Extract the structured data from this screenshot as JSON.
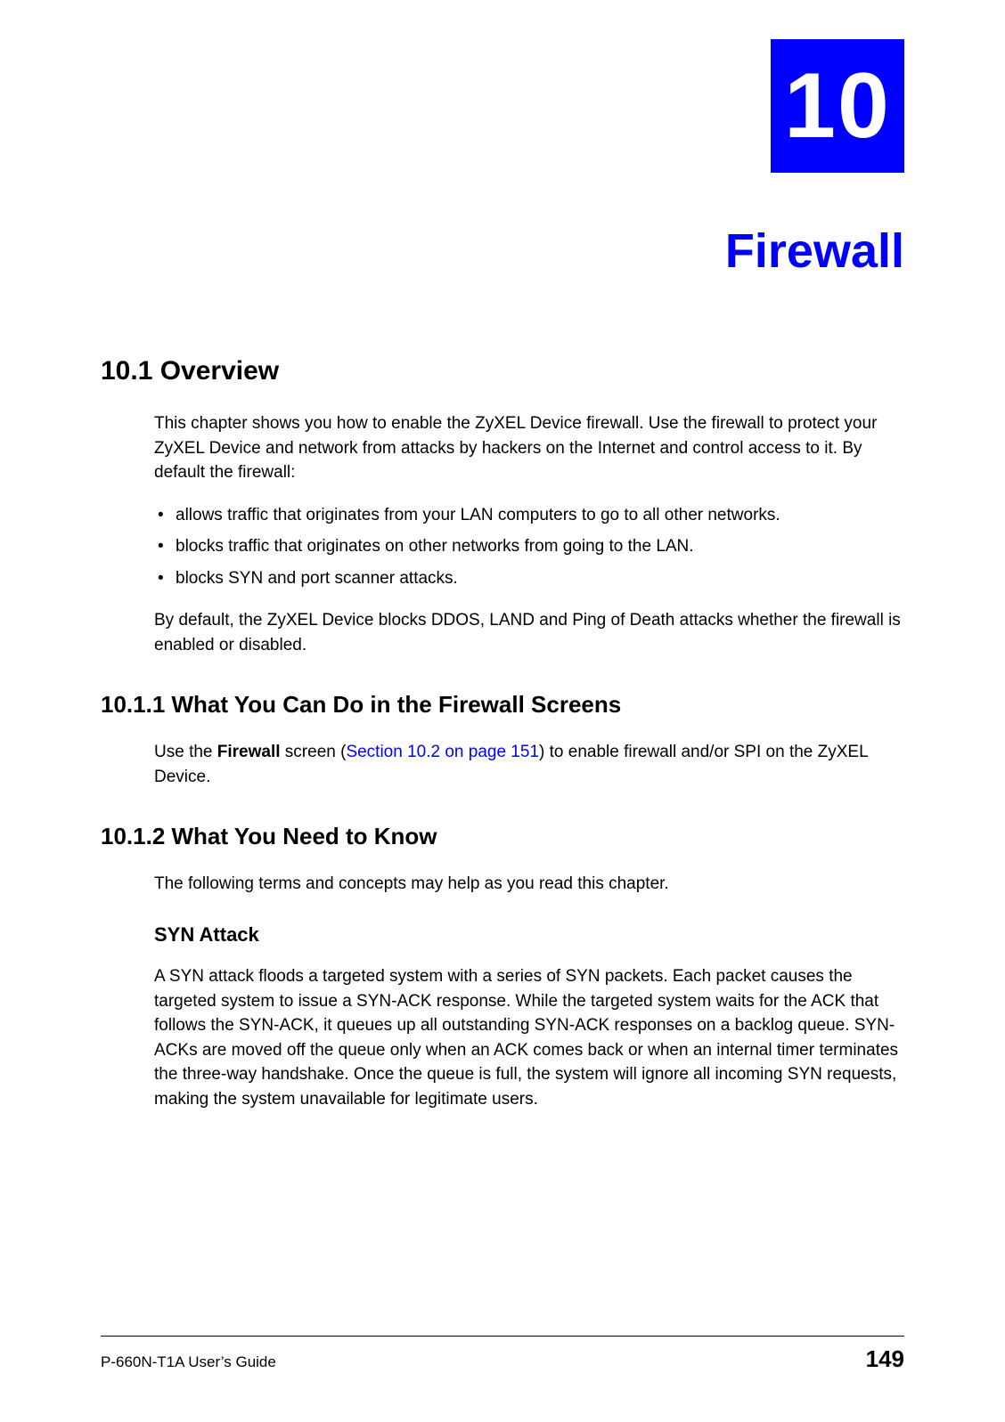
{
  "chapter": {
    "number": "10",
    "title": "Firewall"
  },
  "sections": {
    "overview": {
      "heading": "10.1  Overview",
      "intro_para": "This chapter shows you how to enable the ZyXEL Device firewall. Use the firewall to protect your ZyXEL Device and network from attacks by hackers on the Internet and control access to it. By default the firewall:",
      "bullets": [
        "allows traffic that originates from your LAN computers to go to all other networks.",
        "blocks traffic that originates on other networks from going to the LAN.",
        "blocks SYN and port scanner attacks."
      ],
      "after_para": "By default, the ZyXEL Device blocks DDOS, LAND and Ping of Death attacks whether the firewall is enabled or disabled."
    },
    "what_you_can_do": {
      "heading": "10.1.1  What You Can Do in the Firewall Screens",
      "para_pre": "Use the ",
      "para_bold": "Firewall",
      "para_mid": " screen (",
      "para_link": "Section 10.2 on page 151",
      "para_post": ") to enable firewall and/or SPI on the ZyXEL Device."
    },
    "what_you_need": {
      "heading": "10.1.2  What You Need to Know",
      "intro": "The following terms and concepts may help as you read this chapter.",
      "syn_heading": "SYN Attack",
      "syn_para": "A SYN attack floods a targeted system with a series of SYN packets. Each packet causes the targeted system to issue a SYN-ACK response. While the targeted system waits for the ACK that follows the SYN-ACK, it queues up all outstanding SYN-ACK responses on a backlog queue. SYN-ACKs are moved off the queue only when an ACK comes back or when an internal timer terminates the three-way handshake. Once the queue is full, the system will ignore all incoming SYN requests, making the system unavailable for legitimate users."
    }
  },
  "footer": {
    "left": "P-660N-T1A User’s Guide",
    "right": "149"
  }
}
